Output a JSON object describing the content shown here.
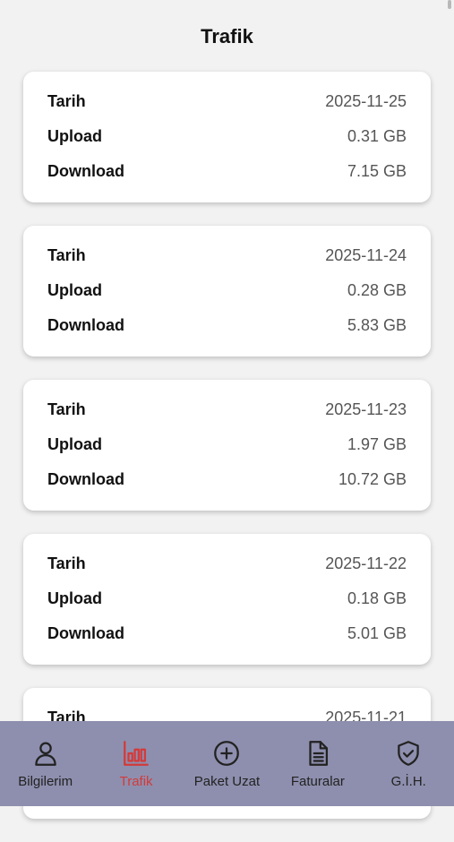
{
  "header": {
    "title": "Trafik"
  },
  "traffic": [
    {
      "date_label": "Tarih",
      "date": "2025-11-25",
      "upload_label": "Upload",
      "upload": "0.31 GB",
      "download_label": "Download",
      "download": "7.15 GB"
    },
    {
      "date_label": "Tarih",
      "date": "2025-11-24",
      "upload_label": "Upload",
      "upload": "0.28 GB",
      "download_label": "Download",
      "download": "5.83 GB"
    },
    {
      "date_label": "Tarih",
      "date": "2025-11-23",
      "upload_label": "Upload",
      "upload": "1.97 GB",
      "download_label": "Download",
      "download": "10.72 GB"
    },
    {
      "date_label": "Tarih",
      "date": "2025-11-22",
      "upload_label": "Upload",
      "upload": "0.18 GB",
      "download_label": "Download",
      "download": "5.01 GB"
    },
    {
      "date_label": "Tarih",
      "date": "2025-11-21"
    }
  ],
  "nav": {
    "items": [
      {
        "label": "Bilgilerim",
        "icon": "user-icon"
      },
      {
        "label": "Trafik",
        "icon": "bar-chart-icon",
        "active": true
      },
      {
        "label": "Paket Uzat",
        "icon": "plus-circle-icon"
      },
      {
        "label": "Faturalar",
        "icon": "document-icon"
      },
      {
        "label": "G.İ.H.",
        "icon": "shield-check-icon"
      }
    ]
  },
  "colors": {
    "nav_background": "#8e8fae",
    "active": "#d33a3a",
    "page_background": "#f2f2f2"
  }
}
